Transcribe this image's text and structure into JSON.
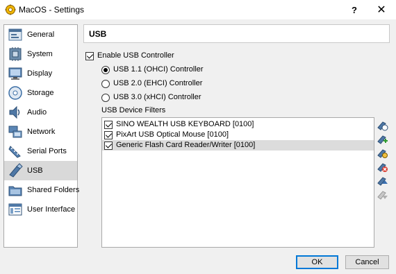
{
  "window": {
    "title": "MacOS - Settings",
    "help_label": "?",
    "close_label": "✕"
  },
  "sidebar": {
    "items": [
      {
        "label": "General",
        "icon": "general-icon"
      },
      {
        "label": "System",
        "icon": "system-icon"
      },
      {
        "label": "Display",
        "icon": "display-icon"
      },
      {
        "label": "Storage",
        "icon": "storage-icon"
      },
      {
        "label": "Audio",
        "icon": "audio-icon"
      },
      {
        "label": "Network",
        "icon": "network-icon"
      },
      {
        "label": "Serial Ports",
        "icon": "serial-ports-icon"
      },
      {
        "label": "USB",
        "icon": "usb-icon",
        "selected": true
      },
      {
        "label": "Shared Folders",
        "icon": "shared-folders-icon"
      },
      {
        "label": "User Interface",
        "icon": "user-interface-icon"
      }
    ]
  },
  "page": {
    "title": "USB",
    "enable_usb": {
      "label": "Enable USB Controller",
      "checked": true
    },
    "controllers": [
      {
        "label": "USB 1.1 (OHCI) Controller",
        "selected": true
      },
      {
        "label": "USB 2.0 (EHCI) Controller",
        "selected": false
      },
      {
        "label": "USB 3.0 (xHCI) Controller",
        "selected": false
      }
    ],
    "filters_label": "USB Device Filters",
    "filters": [
      {
        "label": "SINO WEALTH USB KEYBOARD [0100]",
        "checked": true
      },
      {
        "label": "PixArt USB Optical Mouse [0100]",
        "checked": true
      },
      {
        "label": "Generic Flash Card Reader/Writer [0100]",
        "checked": true,
        "selected": true
      }
    ],
    "filter_tools": [
      "add-empty-filter-icon",
      "add-device-filter-icon",
      "edit-filter-icon",
      "remove-filter-icon",
      "move-up-icon",
      "move-down-icon"
    ]
  },
  "buttons": {
    "ok": "OK",
    "cancel": "Cancel"
  },
  "colors": {
    "accent": "#0078d7",
    "selected_bg": "#d9d9d9"
  }
}
